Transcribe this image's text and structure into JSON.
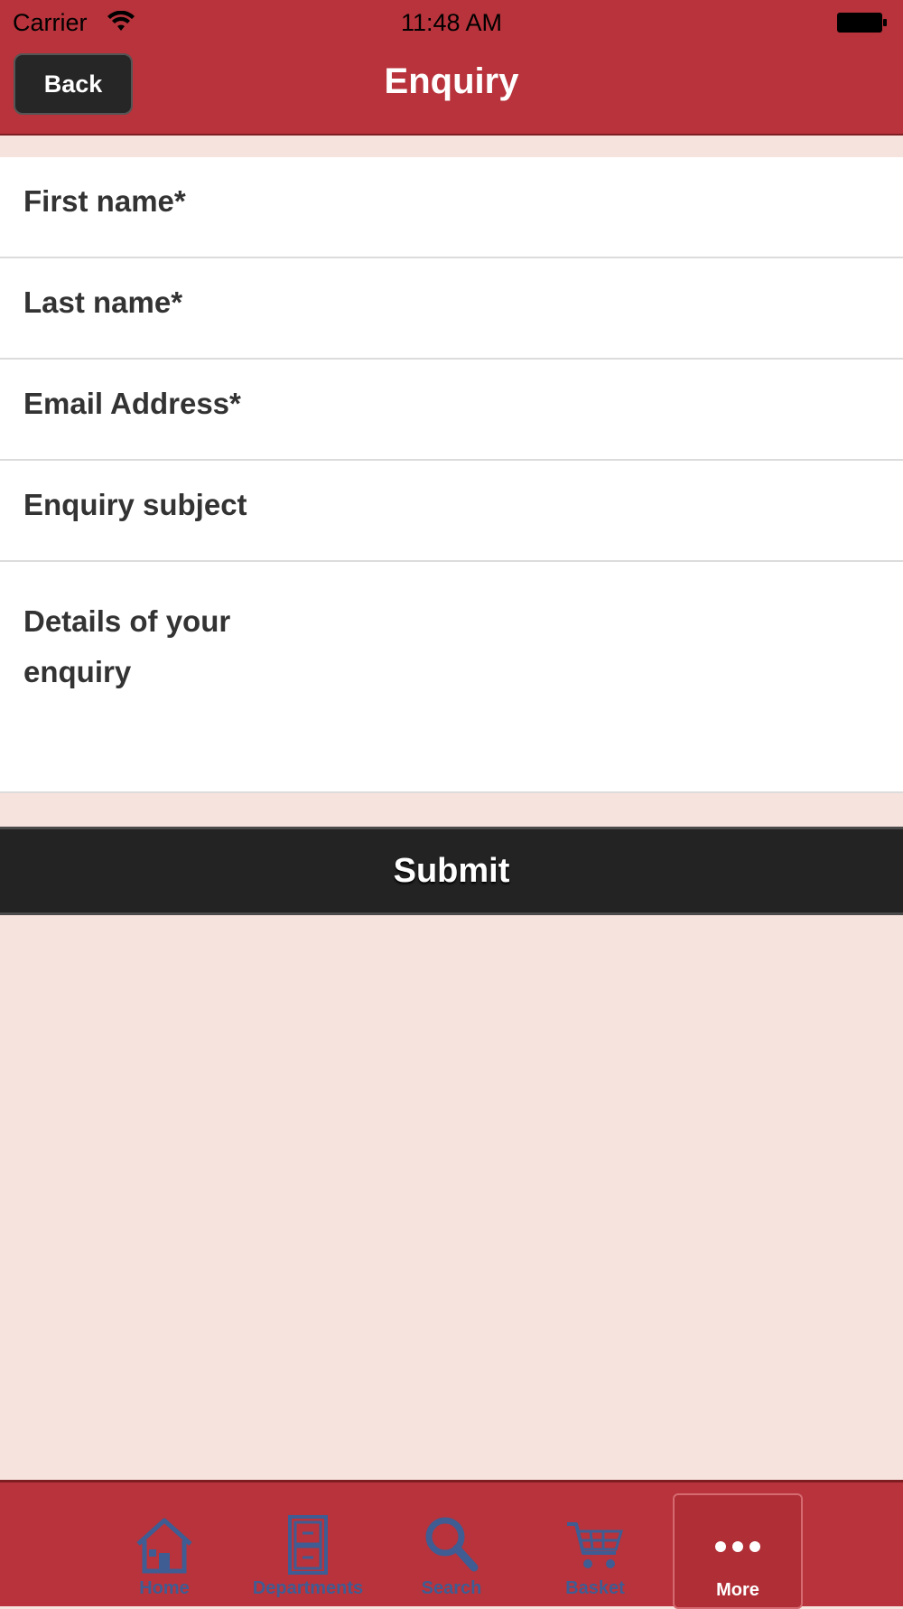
{
  "status_bar": {
    "carrier": "Carrier",
    "time": "11:48 AM"
  },
  "nav": {
    "back_label": "Back",
    "title": "Enquiry"
  },
  "form": {
    "fields": [
      {
        "label": "First name*"
      },
      {
        "label": "Last name*"
      },
      {
        "label": "Email Address*"
      },
      {
        "label": "Enquiry subject"
      }
    ],
    "details_label": "Details of your enquiry"
  },
  "submit_label": "Submit",
  "tabbar": {
    "items": [
      {
        "label": "Home",
        "icon": "home-icon"
      },
      {
        "label": "Departments",
        "icon": "cabinet-icon"
      },
      {
        "label": "Search",
        "icon": "search-icon"
      },
      {
        "label": "Basket",
        "icon": "cart-icon"
      },
      {
        "label": "More",
        "icon": "more-icon",
        "active": true
      }
    ]
  },
  "colors": {
    "brand_red": "#b8333b",
    "background": "#f7e3de",
    "button_dark": "#232323",
    "tab_icon_blue": "#3f5c93"
  }
}
